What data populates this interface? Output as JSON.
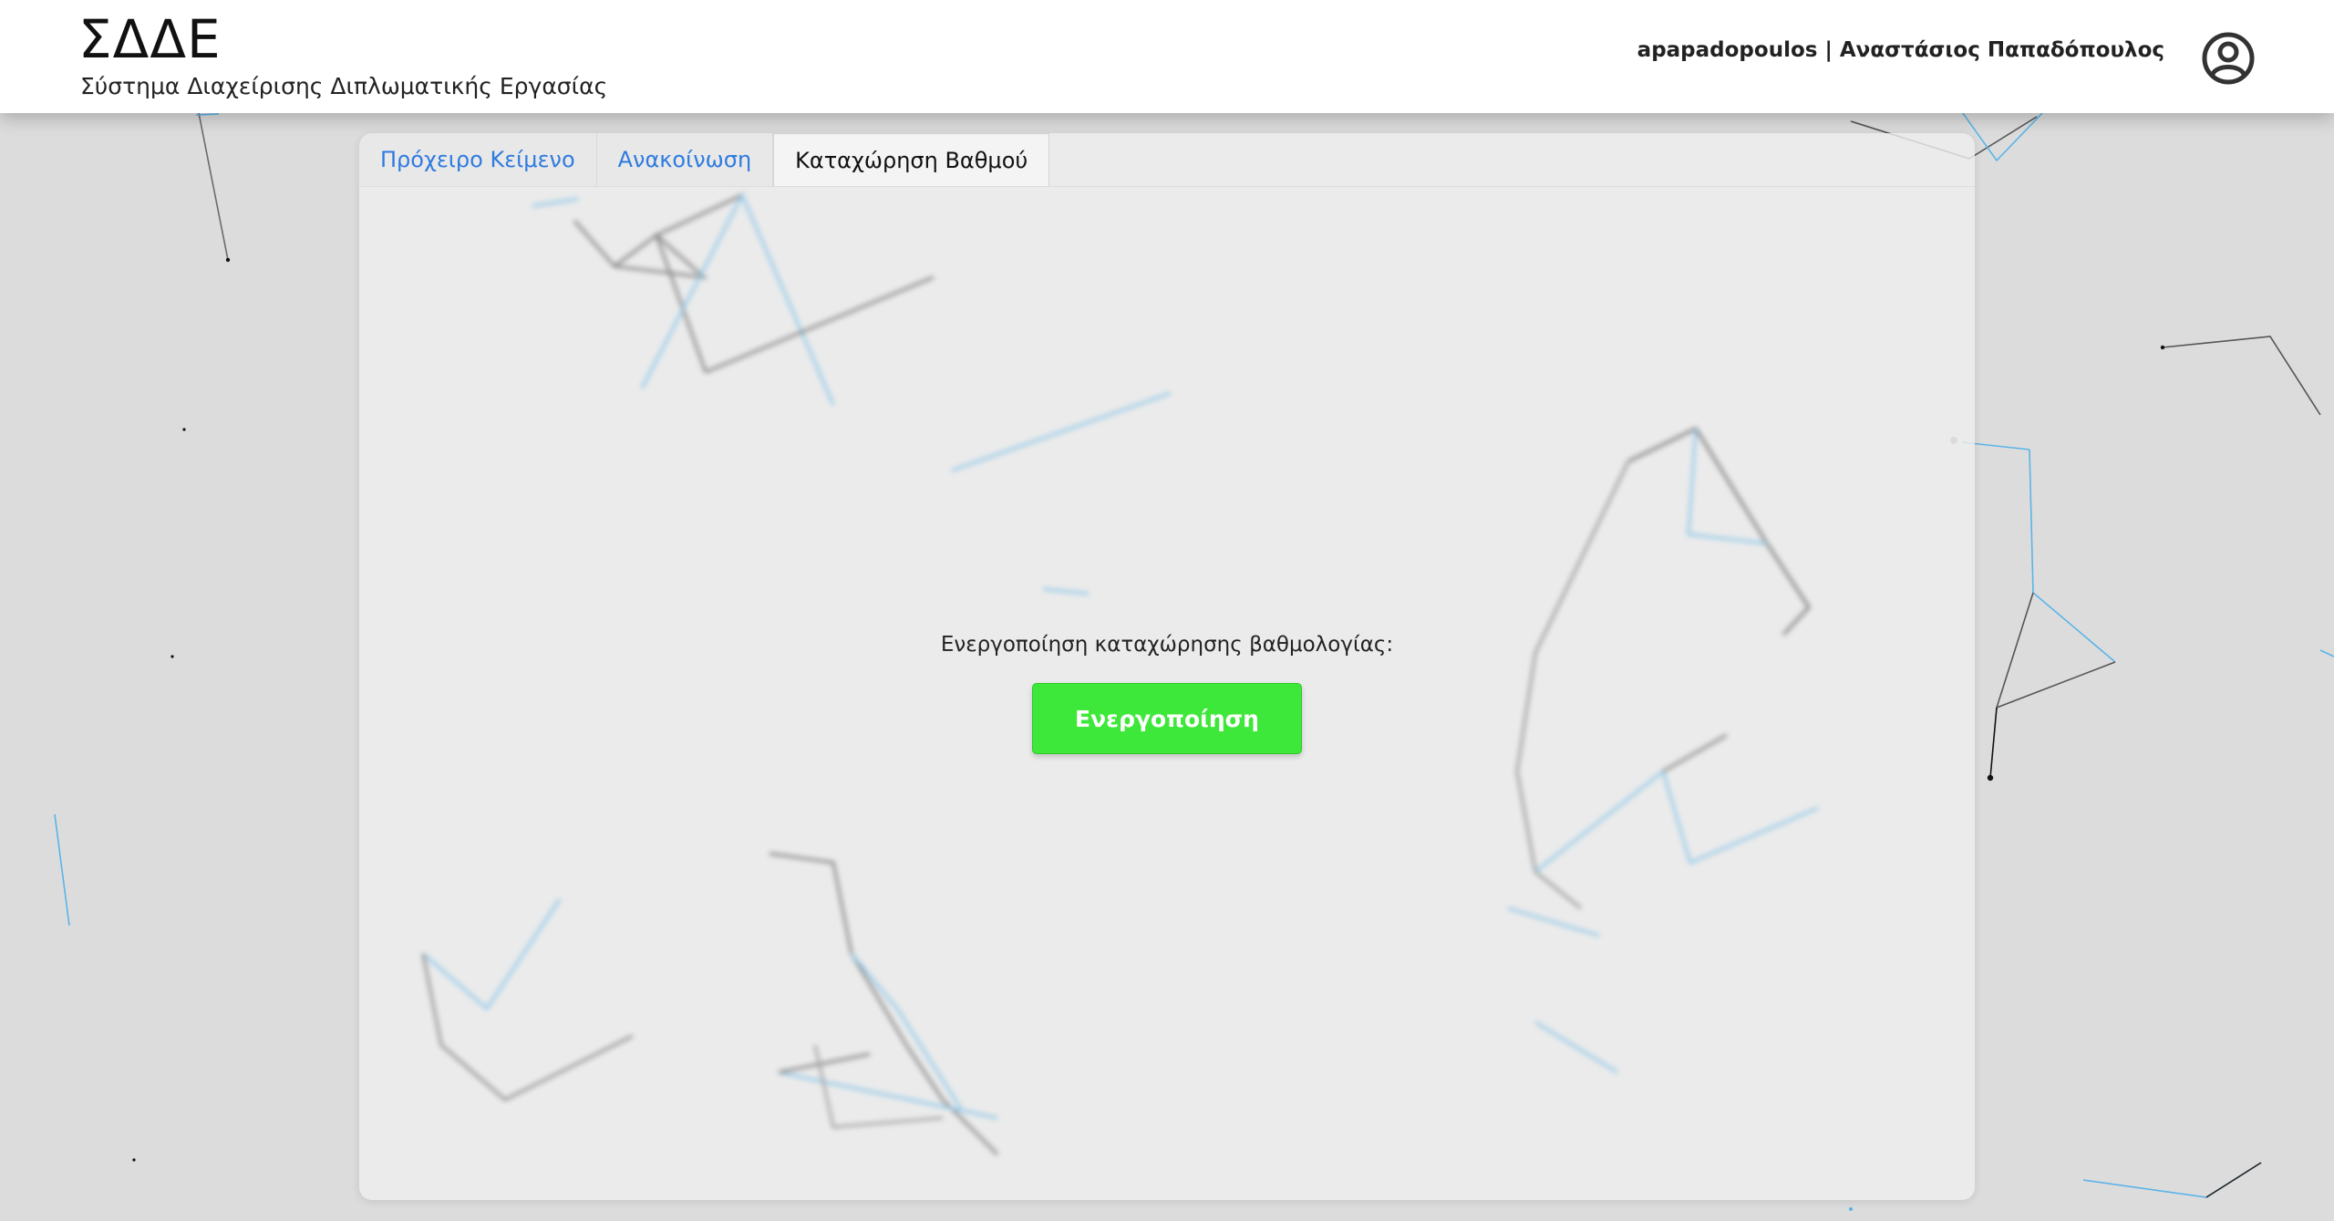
{
  "header": {
    "title": "ΣΔΔΕ",
    "subtitle": "Σύστημα Διαχείρισης Διπλωματικής Εργασίας",
    "user": {
      "username": "apapadopoulos",
      "separator": "|",
      "full_name": "Αναστάσιος Παπαδόπουλος"
    },
    "avatar_icon": "user-circle-icon"
  },
  "tabs": [
    {
      "label": "Πρόχειρο Κείμενο",
      "active": false
    },
    {
      "label": "Ανακοίνωση",
      "active": false
    },
    {
      "label": "Καταχώρηση Βαθμού",
      "active": true
    }
  ],
  "panel": {
    "label": "Ενεργοποίηση καταχώρησης βαθμολογίας:",
    "button_label": "Ενεργοποίηση"
  },
  "colors": {
    "link_blue": "#2f7be0",
    "button_green": "#3ee83a",
    "background": "#dcdcdc"
  }
}
